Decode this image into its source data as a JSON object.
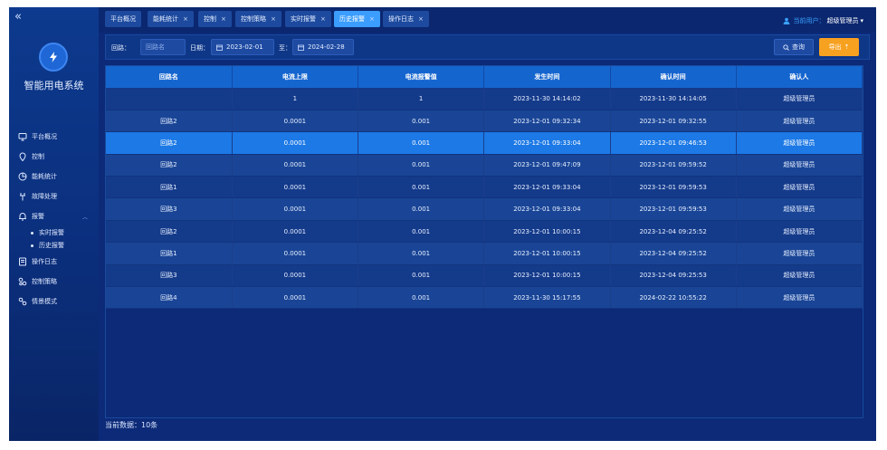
{
  "sidebar": {
    "collapse_icon": "double-chevron-left",
    "app_title": "智能用电系统",
    "menu": [
      {
        "label": "平台概况",
        "icon": "monitor-icon"
      },
      {
        "label": "控制",
        "icon": "pin-icon"
      },
      {
        "label": "能耗统计",
        "icon": "pie-icon"
      },
      {
        "label": "故障处理",
        "icon": "tool-icon"
      },
      {
        "label": "报警",
        "icon": "bell-icon",
        "expanded": true,
        "children": [
          {
            "label": "实时报警"
          },
          {
            "label": "历史报警"
          }
        ]
      },
      {
        "label": "操作日志",
        "icon": "log-icon"
      },
      {
        "label": "控制策略",
        "icon": "flow-icon"
      },
      {
        "label": "情景模式",
        "icon": "scene-icon"
      }
    ]
  },
  "tabs": [
    {
      "label": "平台概况",
      "closable": false,
      "active": false
    },
    {
      "label": "能耗统计",
      "closable": true,
      "active": false
    },
    {
      "label": "控制",
      "closable": true,
      "active": false
    },
    {
      "label": "控制策略",
      "closable": true,
      "active": false
    },
    {
      "label": "实时报警",
      "closable": true,
      "active": false
    },
    {
      "label": "历史报警",
      "closable": true,
      "active": true
    },
    {
      "label": "操作日志",
      "closable": true,
      "active": false
    }
  ],
  "tab_close": "×",
  "user": {
    "prefix": "当前用户：",
    "name": "超级管理员",
    "caret": "▾"
  },
  "filter": {
    "loop_label": "回路：",
    "loop_placeholder": "回路名",
    "date_label": "日期：",
    "date_start": "2023-02-01",
    "to_label": "至：",
    "date_end": "2024-02-28",
    "query_label": "查询",
    "export_label": "导出",
    "export_icon": "⇡"
  },
  "table": {
    "headers": [
      "回路名",
      "电流上限",
      "电流报警值",
      "发生时间",
      "确认时间",
      "确认人"
    ],
    "rows": [
      [
        "",
        "1",
        "1",
        "2023-11-30 14:14:02",
        "2023-11-30 14:14:05",
        "超级管理员"
      ],
      [
        "回路2",
        "0.0001",
        "0.001",
        "2023-12-01 09:32:34",
        "2023-12-01 09:32:55",
        "超级管理员"
      ],
      [
        "回路2",
        "0.0001",
        "0.001",
        "2023-12-01 09:33:04",
        "2023-12-01 09:46:53",
        "超级管理员"
      ],
      [
        "回路2",
        "0.0001",
        "0.001",
        "2023-12-01 09:47:09",
        "2023-12-01 09:59:52",
        "超级管理员"
      ],
      [
        "回路1",
        "0.0001",
        "0.001",
        "2023-12-01 09:33:04",
        "2023-12-01 09:59:53",
        "超级管理员"
      ],
      [
        "回路3",
        "0.0001",
        "0.001",
        "2023-12-01 09:33:04",
        "2023-12-01 09:59:53",
        "超级管理员"
      ],
      [
        "回路2",
        "0.0001",
        "0.001",
        "2023-12-01 10:00:15",
        "2023-12-04 09:25:52",
        "超级管理员"
      ],
      [
        "回路1",
        "0.0001",
        "0.001",
        "2023-12-01 10:00:15",
        "2023-12-04 09:25:52",
        "超级管理员"
      ],
      [
        "回路3",
        "0.0001",
        "0.001",
        "2023-12-01 10:00:15",
        "2023-12-04 09:25:53",
        "超级管理员"
      ],
      [
        "回路4",
        "0.0001",
        "0.001",
        "2023-11-30 15:17:55",
        "2024-02-22 10:55:22",
        "超级管理员"
      ]
    ],
    "selected_row": 2
  },
  "footer": {
    "count_text": "当前数据：10条"
  },
  "colors": {
    "accent": "#3b9dff",
    "export": "#f7a120",
    "header": "#1565cf",
    "selected": "#1c79e6"
  }
}
